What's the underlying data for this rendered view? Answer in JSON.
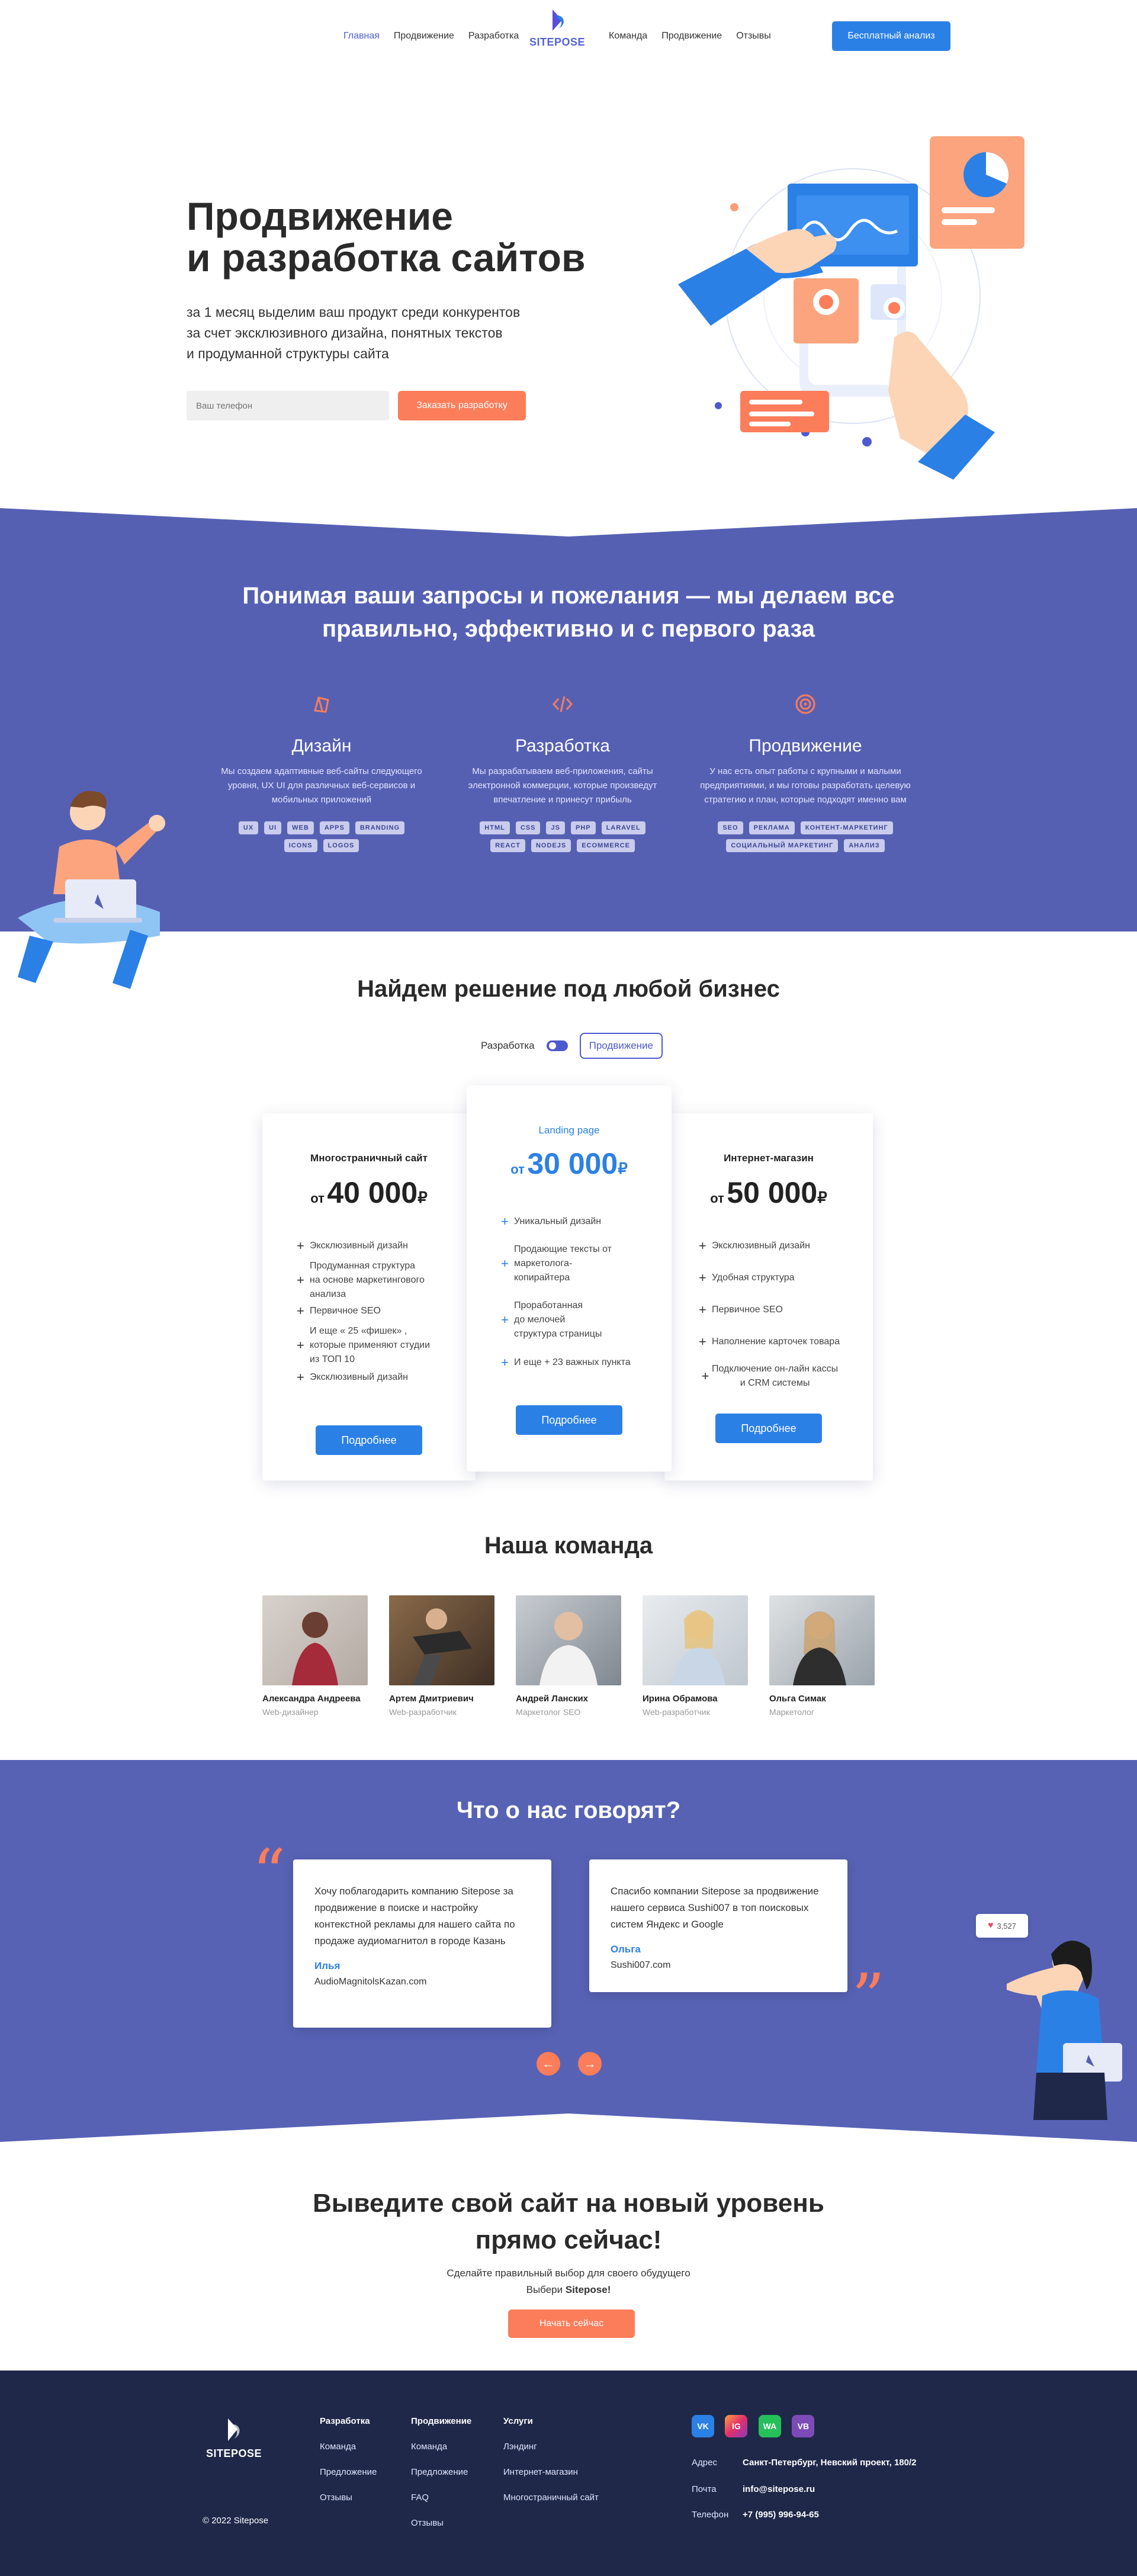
{
  "header": {
    "nav_left": [
      "Главная",
      "Продвижение",
      "Разработка"
    ],
    "nav_right": [
      "Команда",
      "Продвижение",
      "Отзывы"
    ],
    "logo": "SITEPOSE",
    "cta": "Бесплатный анализ"
  },
  "hero": {
    "title_line1": "Продвижение",
    "title_line2": "и разработка сайтов",
    "lead_line1": "за 1 месяц выделим ваш продукт среди конкурентов",
    "lead_line2": "за счет эксклюзивного дизайна, понятных текстов",
    "lead_line3": "и продуманной структуры сайта",
    "phone_placeholder": "Ваш телефон",
    "order_button": "Заказать разработку"
  },
  "services": {
    "title_line1": "Понимая ваши запросы и пожелания — мы делаем все",
    "title_line2": "правильно, эффективно и с первого раза",
    "items": [
      {
        "name": "Дизайн",
        "icon": "design-icon",
        "text": "Мы создаем адаптивные веб-сайты следующего уровня, UX UI для различных веб-сервисов и мобильных приложений",
        "tags": [
          "UX",
          "UI",
          "WEB",
          "APPS",
          "BRANDING",
          "ICONS",
          "LOGOS"
        ]
      },
      {
        "name": "Разработка",
        "icon": "code-icon",
        "text": "Мы разрабатываем веб-приложения, сайты электронной коммерции, которые произведут впечатление и принесут прибыль",
        "tags": [
          "HTML",
          "CSS",
          "JS",
          "PHP",
          "LARAVEL",
          "REACT",
          "NODEJS",
          "ECOMMERCE"
        ]
      },
      {
        "name": "Продвижение",
        "icon": "target-icon",
        "text": "У нас есть опыт работы с крупными и малыми предприятиями, и мы готовы разработать целевую стратегию и план, которые подходят именно вам",
        "tags": [
          "SEO",
          "РЕКЛАМА",
          "КОНТЕНТ-МАРКЕТИНГ",
          "СОЦИАЛЬНЫЙ МАРКЕТИНГ",
          "АНАЛИЗ"
        ]
      }
    ]
  },
  "pricing": {
    "title": "Найдем решение под любой бизнес",
    "toggle_left": "Разработка",
    "toggle_right": "Продвижение",
    "price_prefix": "от",
    "currency": "₽",
    "more": "Подробнее",
    "cards": [
      {
        "name": "Многостраничный сайт",
        "price": "40 000",
        "features": [
          "Эксклюзивный дизайн",
          "Продуманная структура\nна основе маркетингового\nанализа",
          "Первичное SEO",
          "И еще « 25 «фишек» ,\nкоторые применяют студии\nиз ТОП 10",
          "Эксклюзивный дизайн"
        ]
      },
      {
        "name": "Landing page",
        "price": "30 000",
        "features": [
          "Уникальный дизайн",
          "Продающие тексты от\nмаркетолога-\nкопирайтера",
          "Проработанная\nдо мелочей\nструктура страницы",
          "И еще + 23 важных пункта"
        ]
      },
      {
        "name": "Интернет-магазин",
        "price": "50 000",
        "features": [
          "Эксклюзивный дизайн",
          "Удобная структура",
          "Первичное SEO",
          "Наполнение карточек товара",
          "Подключение он-лайн кассы\nи CRM системы"
        ]
      }
    ]
  },
  "team": {
    "title": "Наша команда",
    "members": [
      {
        "name": "Александра Андреева",
        "role": "Web-дизайнер"
      },
      {
        "name": "Артем Дмитриевич",
        "role": "Web-разработчик"
      },
      {
        "name": "Андрей Ланских",
        "role": "Маркетолог SEO"
      },
      {
        "name": "Ирина Обрамова",
        "role": "Web-разработчик"
      },
      {
        "name": "Ольга Симак",
        "role": "Маркетолог"
      }
    ]
  },
  "reviews": {
    "title": "Что о нас говорят?",
    "items": [
      {
        "text": "Хочу поблагодарить компанию Sitepose за продвижение в поиске и настройку контекстной рекламы для нашего сайта по продаже аудиомагнитол в городе Казань",
        "author": "Илья",
        "site": "AudioMagnitolsKazan.com"
      },
      {
        "text": "Спасибо компании Sitepose за продвижение нашего сервиса Sushi007 в топ поисковых систем Яндекс и Google",
        "author": "Ольга",
        "site": "Sushi007.com"
      }
    ],
    "likes": "3,527",
    "prev": "←",
    "next": "→"
  },
  "cta": {
    "title_line1": "Выведите свой сайт на новый уровень",
    "title_line2": "прямо сейчас!",
    "sub_line1": "Сделайте правильный выбор для своего обудущего",
    "sub_prefix": "Выбери ",
    "sub_brand": "Sitepose!",
    "button": "Начать сейчас"
  },
  "footer": {
    "logo": "SITEPOSE",
    "copyright": "© 2022 Sitepose",
    "col1": {
      "head": "Разработка",
      "items": [
        "Команда",
        "Предложение",
        "Отзывы"
      ]
    },
    "col2": {
      "head": "Продвижение",
      "items": [
        "Команда",
        "Предложение",
        "FAQ",
        "Отзывы"
      ]
    },
    "col3": {
      "head": "Услуги",
      "items": [
        "Лэндинг",
        "Интернет-магазин",
        "Многостраничный сайт"
      ]
    },
    "social": [
      {
        "label": "VK",
        "color": "#2b80e6"
      },
      {
        "label": "IG",
        "color": "#e1306c"
      },
      {
        "label": "WA",
        "color": "#25c05a"
      },
      {
        "label": "VB",
        "color": "#7d4bb8"
      }
    ],
    "contacts": [
      {
        "label": "Адрес",
        "value": "Санкт-Петербург, Невский проект, 180/2"
      },
      {
        "label": "Почта",
        "value": "info@sitepose.ru"
      },
      {
        "label": "Телефон",
        "value": "+7 (995) 996-94-65"
      }
    ]
  },
  "colors": {
    "accent": "#2b80e6",
    "purple": "#5660b3",
    "orange": "#fb7d5a",
    "footer": "#1f2849"
  }
}
